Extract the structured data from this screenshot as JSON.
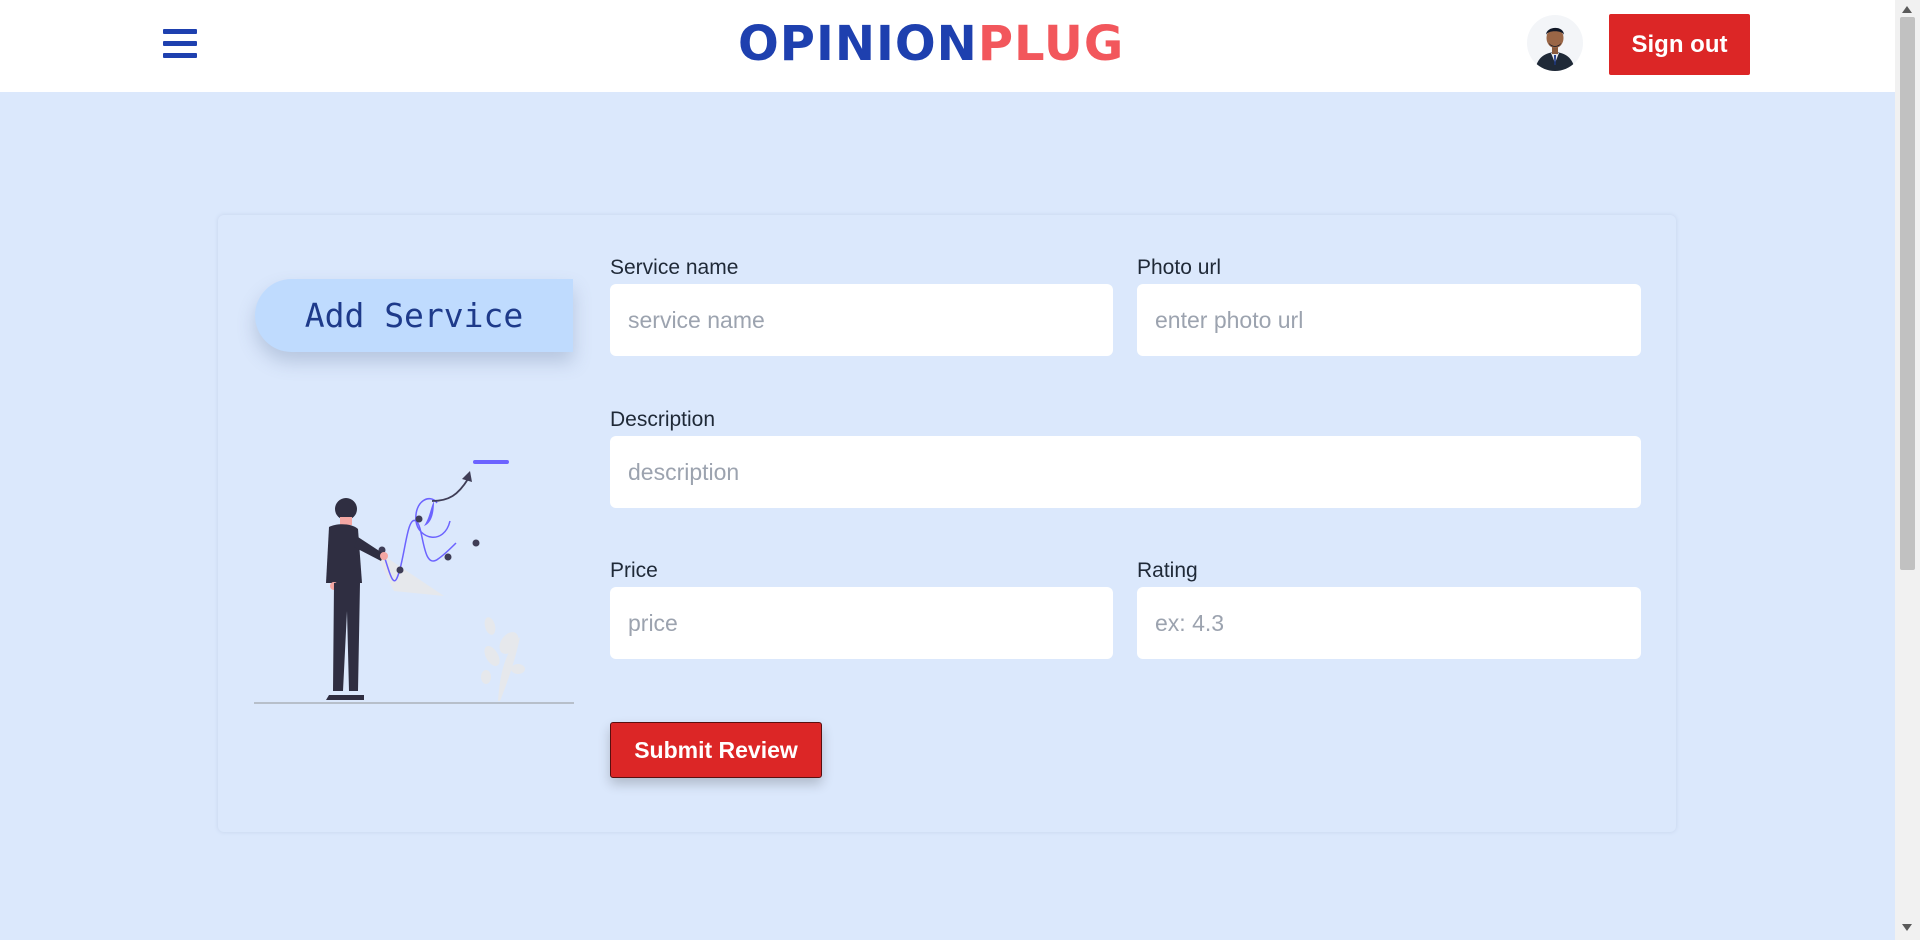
{
  "header": {
    "logo_part1": "OPINION",
    "logo_part2": "PLUG",
    "signout_label": "Sign out"
  },
  "form": {
    "heading": "Add Service",
    "service_name": {
      "label": "Service name",
      "placeholder": "service name"
    },
    "photo_url": {
      "label": "Photo url",
      "placeholder": "enter photo url"
    },
    "description": {
      "label": "Description",
      "placeholder": "description"
    },
    "price": {
      "label": "Price",
      "placeholder": "price"
    },
    "rating": {
      "label": "Rating",
      "placeholder": "ex: 4.3"
    },
    "submit_label": "Submit Review"
  },
  "colors": {
    "brand_blue": "#1e40af",
    "brand_coral": "#f2575c",
    "button_red": "#dc2626",
    "page_bg": "#dbe8fc"
  },
  "icons": {
    "menu": "hamburger-icon",
    "avatar": "user-avatar",
    "illustration": "presentation-illustration"
  }
}
